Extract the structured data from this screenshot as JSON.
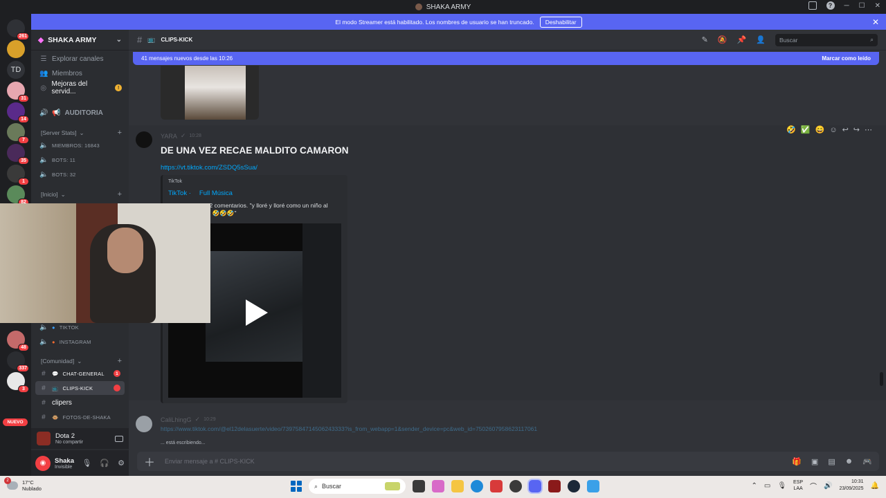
{
  "window": {
    "title": "SHAKA ARMY"
  },
  "streamer_banner": {
    "text": "El modo Streamer está habilitado. Los nombres de usuario se han truncado.",
    "button": "Deshabilitar"
  },
  "servers": [
    {
      "badge": "261"
    },
    {
      "label": "TD"
    },
    {
      "badge": "31"
    },
    {
      "badge": "14"
    },
    {
      "badge": "7"
    },
    {
      "badge": "35"
    },
    {
      "badge": "1"
    },
    {
      "badge": "82"
    },
    {
      "badge": "48"
    },
    {
      "badge": "337"
    },
    {
      "badge": "3"
    }
  ],
  "nuevo_label": "NUEVO",
  "sidebar": {
    "guild_name": "SHAKA ARMY",
    "top_items": [
      {
        "label": "Explorar canales",
        "icon": "compass-icon"
      },
      {
        "label": "Miembros",
        "icon": "members-icon"
      },
      {
        "label": "Mejoras del servid...",
        "icon": "boost-icon",
        "badge": "!"
      }
    ],
    "auditoria": "AUDITORIA",
    "cat_stats": "[Server Stats]",
    "stats": [
      "MIEMBROS: 16843",
      "BOTS: 11",
      "BOTS: 32"
    ],
    "cat_inicio": "[Inicio]",
    "social": [
      "TIKTOK",
      "INSTAGRAM"
    ],
    "cat_comunidad": "[Comunidad]",
    "comunidad": [
      {
        "label": "CHAT-GENERAL",
        "badge": "1"
      },
      {
        "label": "CLIPS-KICK",
        "badge": ""
      },
      {
        "label": "clipers"
      },
      {
        "label": "FOTOS-DE-SHAKA"
      }
    ],
    "activity": {
      "game": "Dota 2",
      "status": "No compartir"
    },
    "user": {
      "name": "Shaka",
      "status": "Invisible"
    }
  },
  "channel": {
    "name": "CLIPS-KICK",
    "search_placeholder": "Buscar"
  },
  "new_messages": {
    "text": "41 mensajes nuevos desde las 10:26",
    "mark_read": "Marcar como leído"
  },
  "messages": [
    {
      "author": "YARA",
      "time": "10:28",
      "text": "DE UNA VEZ RECAE MALDITO CAMARON",
      "link": "https://vt.tiktok.com/ZSDQ5sSua/",
      "embed": {
        "provider": "TikTok",
        "author": "TikTok ·",
        "music": "Full Música",
        "desc_line1": "302 comentarios. \"y lloré y lloré como un niño al",
        "desc_line2": "ido 🤣🤣🤣\""
      }
    },
    {
      "author": "CaliLhingG",
      "time": "10:29",
      "link": "https://www.tiktok.com/@el12delasuerte/video/7397584714506243333?is_from_webapp=1&sender_device=pc&web_id=7502607958623117061"
    }
  ],
  "typing": "... está escribiendo...",
  "composer": {
    "placeholder": "Enviar mensaje a # CLIPS-KICK"
  },
  "taskbar": {
    "weather_temp": "17°C",
    "weather_desc": "Nublado",
    "weather_badge": "2",
    "search": "Buscar",
    "lang1": "ESP",
    "lang2": "LAA",
    "time": "10:31",
    "date": "23/09/2025"
  }
}
